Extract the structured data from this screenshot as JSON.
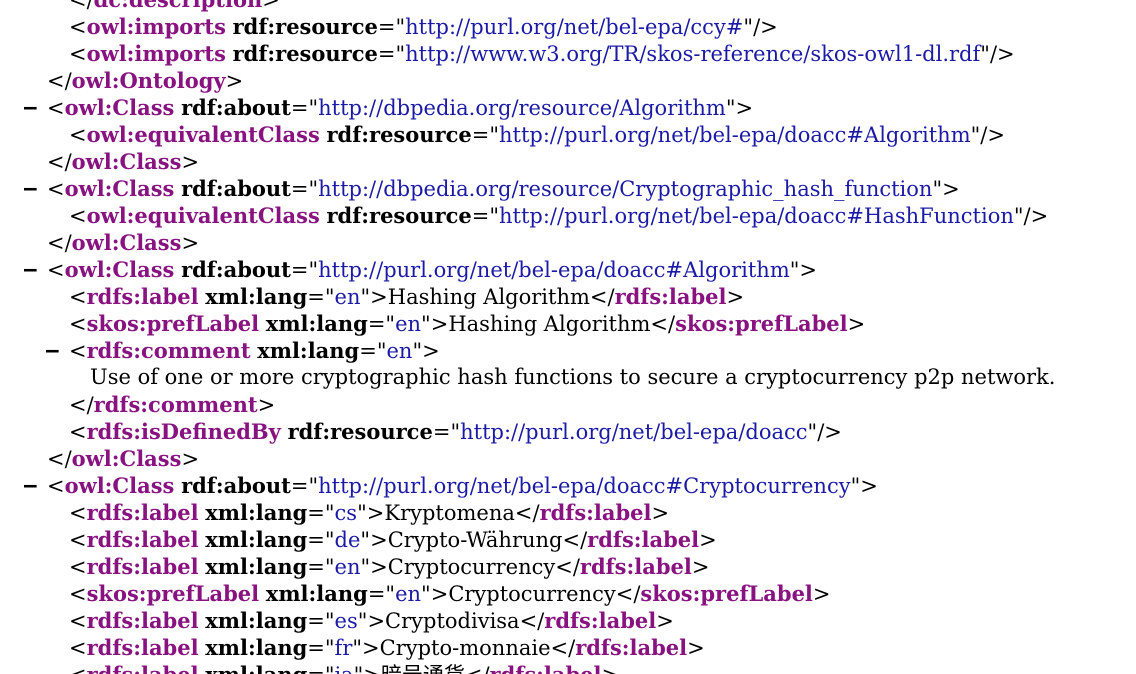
{
  "colors": {
    "tag": "#881280",
    "attribute": "#000000",
    "value": "#1a1aa6",
    "text": "#000000",
    "background": "#ffffff"
  },
  "collapse_symbol": "–",
  "lines": [
    {
      "indent": 1,
      "collapse": false,
      "kind": "close",
      "tag": "dc:description"
    },
    {
      "indent": 1,
      "collapse": false,
      "kind": "selfclose",
      "tag": "owl:imports",
      "attrs": [
        {
          "name": "rdf:resource",
          "value": "http://purl.org/net/bel-epa/ccy#"
        }
      ]
    },
    {
      "indent": 1,
      "collapse": false,
      "kind": "selfclose",
      "tag": "owl:imports",
      "attrs": [
        {
          "name": "rdf:resource",
          "value": "http://www.w3.org/TR/skos-reference/skos-owl1-dl.rdf"
        }
      ]
    },
    {
      "indent": 0,
      "collapse": false,
      "kind": "close",
      "tag": "owl:Ontology"
    },
    {
      "indent": 0,
      "collapse": true,
      "kind": "open",
      "tag": "owl:Class",
      "attrs": [
        {
          "name": "rdf:about",
          "value": "http://dbpedia.org/resource/Algorithm"
        }
      ]
    },
    {
      "indent": 1,
      "collapse": false,
      "kind": "selfclose",
      "tag": "owl:equivalentClass",
      "attrs": [
        {
          "name": "rdf:resource",
          "value": "http://purl.org/net/bel-epa/doacc#Algorithm"
        }
      ]
    },
    {
      "indent": 0,
      "collapse": false,
      "kind": "close",
      "tag": "owl:Class"
    },
    {
      "indent": 0,
      "collapse": true,
      "kind": "open",
      "tag": "owl:Class",
      "attrs": [
        {
          "name": "rdf:about",
          "value": "http://dbpedia.org/resource/Cryptographic_hash_function"
        }
      ]
    },
    {
      "indent": 1,
      "collapse": false,
      "kind": "selfclose",
      "tag": "owl:equivalentClass",
      "attrs": [
        {
          "name": "rdf:resource",
          "value": "http://purl.org/net/bel-epa/doacc#HashFunction"
        }
      ]
    },
    {
      "indent": 0,
      "collapse": false,
      "kind": "close",
      "tag": "owl:Class"
    },
    {
      "indent": 0,
      "collapse": true,
      "kind": "open",
      "tag": "owl:Class",
      "attrs": [
        {
          "name": "rdf:about",
          "value": "http://purl.org/net/bel-epa/doacc#Algorithm"
        }
      ]
    },
    {
      "indent": 1,
      "collapse": false,
      "kind": "inline",
      "tag": "rdfs:label",
      "attrs": [
        {
          "name": "xml:lang",
          "value": "en"
        }
      ],
      "text": "Hashing Algorithm"
    },
    {
      "indent": 1,
      "collapse": false,
      "kind": "inline",
      "tag": "skos:prefLabel",
      "attrs": [
        {
          "name": "xml:lang",
          "value": "en"
        }
      ],
      "text": "Hashing Algorithm"
    },
    {
      "indent": 1,
      "collapse": true,
      "kind": "open",
      "tag": "rdfs:comment",
      "attrs": [
        {
          "name": "xml:lang",
          "value": "en"
        }
      ]
    },
    {
      "indent": 2,
      "collapse": false,
      "kind": "text",
      "text": "Use of one or more cryptographic hash functions to secure a cryptocurrency p2p network."
    },
    {
      "indent": 1,
      "collapse": false,
      "kind": "close",
      "tag": "rdfs:comment"
    },
    {
      "indent": 1,
      "collapse": false,
      "kind": "selfclose",
      "tag": "rdfs:isDefinedBy",
      "attrs": [
        {
          "name": "rdf:resource",
          "value": "http://purl.org/net/bel-epa/doacc"
        }
      ]
    },
    {
      "indent": 0,
      "collapse": false,
      "kind": "close",
      "tag": "owl:Class"
    },
    {
      "indent": 0,
      "collapse": true,
      "kind": "open",
      "tag": "owl:Class",
      "attrs": [
        {
          "name": "rdf:about",
          "value": "http://purl.org/net/bel-epa/doacc#Cryptocurrency"
        }
      ]
    },
    {
      "indent": 1,
      "collapse": false,
      "kind": "inline",
      "tag": "rdfs:label",
      "attrs": [
        {
          "name": "xml:lang",
          "value": "cs"
        }
      ],
      "text": "Kryptomena"
    },
    {
      "indent": 1,
      "collapse": false,
      "kind": "inline",
      "tag": "rdfs:label",
      "attrs": [
        {
          "name": "xml:lang",
          "value": "de"
        }
      ],
      "text": "Crypto-Währung"
    },
    {
      "indent": 1,
      "collapse": false,
      "kind": "inline",
      "tag": "rdfs:label",
      "attrs": [
        {
          "name": "xml:lang",
          "value": "en"
        }
      ],
      "text": "Cryptocurrency"
    },
    {
      "indent": 1,
      "collapse": false,
      "kind": "inline",
      "tag": "skos:prefLabel",
      "attrs": [
        {
          "name": "xml:lang",
          "value": "en"
        }
      ],
      "text": "Cryptocurrency"
    },
    {
      "indent": 1,
      "collapse": false,
      "kind": "inline",
      "tag": "rdfs:label",
      "attrs": [
        {
          "name": "xml:lang",
          "value": "es"
        }
      ],
      "text": "Cryptodivisa"
    },
    {
      "indent": 1,
      "collapse": false,
      "kind": "inline",
      "tag": "rdfs:label",
      "attrs": [
        {
          "name": "xml:lang",
          "value": "fr"
        }
      ],
      "text": "Crypto-monnaie"
    },
    {
      "indent": 1,
      "collapse": false,
      "kind": "inline",
      "tag": "rdfs:label",
      "attrs": [
        {
          "name": "xml:lang",
          "value": "ja"
        }
      ],
      "text": "暗号通貨"
    }
  ]
}
